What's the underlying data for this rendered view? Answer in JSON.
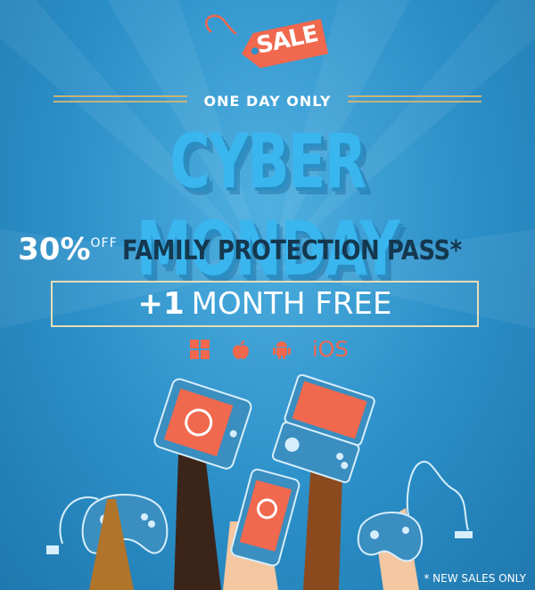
{
  "sale_tag": {
    "label": "SALE"
  },
  "subtitle": "ONE DAY ONLY",
  "headline": "CYBER MONDAY",
  "offer": {
    "percent": "30%",
    "off": "OFF",
    "product": "FAMILY PROTECTION PASS*"
  },
  "bonus": {
    "plus": "+1",
    "text": "MONTH FREE"
  },
  "platforms": [
    {
      "name": "windows-icon"
    },
    {
      "name": "apple-icon"
    },
    {
      "name": "android-icon"
    },
    {
      "name": "ios-label",
      "label": "iOS"
    }
  ],
  "footnote": "* NEW SALES ONLY",
  "colors": {
    "background": "#2b8fc8",
    "headline": "#3ab6ef",
    "accent": "#f0684e",
    "product": "#14384f",
    "rule": "#c9b27a"
  }
}
